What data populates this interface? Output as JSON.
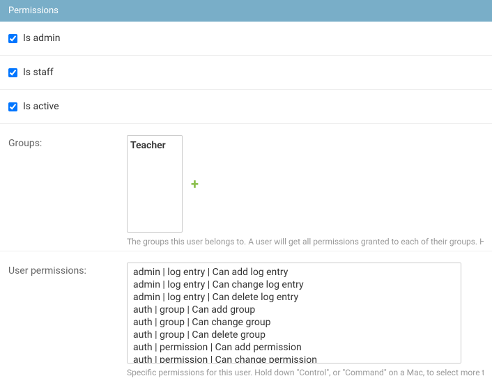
{
  "header": {
    "title": "Permissions"
  },
  "checkboxes": {
    "is_admin": {
      "label": "Is admin",
      "checked": true
    },
    "is_staff": {
      "label": "Is staff",
      "checked": true
    },
    "is_active": {
      "label": "Is active",
      "checked": true
    }
  },
  "groups": {
    "label": "Groups:",
    "options": [
      "Teacher"
    ],
    "help": "The groups this user belongs to. A user will get all permissions granted to each of their groups. Hold down"
  },
  "user_permissions": {
    "label": "User permissions:",
    "options": [
      "admin | log entry | Can add log entry",
      "admin | log entry | Can change log entry",
      "admin | log entry | Can delete log entry",
      "auth | group | Can add group",
      "auth | group | Can change group",
      "auth | group | Can delete group",
      "auth | permission | Can add permission",
      "auth | permission | Can change permission"
    ],
    "help": "Specific permissions for this user. Hold down \"Control\", or \"Command\" on a Mac, to select more than one."
  }
}
